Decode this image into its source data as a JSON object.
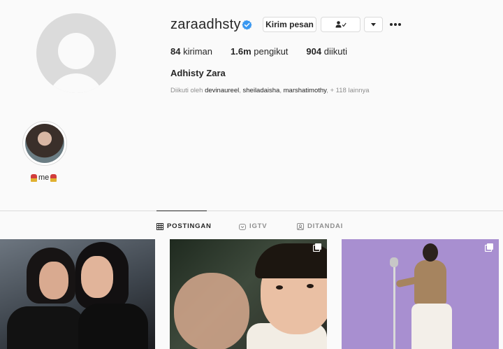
{
  "profile": {
    "username": "zaraadhsty",
    "verified_icon": "verified-badge-icon",
    "message_label": "Kirim pesan",
    "following_icon": "person-check-icon",
    "dropdown_icon": "caret-down-icon",
    "more_icon": "ellipsis-icon",
    "stats": {
      "posts_count": "84",
      "posts_label": "kiriman",
      "followers_count": "1.6m",
      "followers_label": "pengikut",
      "following_count": "904",
      "following_label": "diikuti"
    },
    "full_name": "Adhisty Zara",
    "followed_by": {
      "prefix": "Diikuti oleh",
      "user1": "devinaureel",
      "user2": "sheiladaisha",
      "user3": "marshatimothy",
      "suffix": "+ 118 lainnya"
    }
  },
  "highlights": [
    {
      "label": "me"
    }
  ],
  "tabs": [
    {
      "label": "POSTINGAN",
      "icon": "grid-icon",
      "active": true
    },
    {
      "label": "IGTV",
      "icon": "igtv-icon",
      "active": false
    },
    {
      "label": "DITANDAI",
      "icon": "tagged-icon",
      "active": false
    }
  ],
  "colors": {
    "verified": "#3897f0",
    "text": "#262626",
    "muted": "#8e8e8e",
    "border": "#dbdbdb",
    "background": "#fafafa"
  }
}
